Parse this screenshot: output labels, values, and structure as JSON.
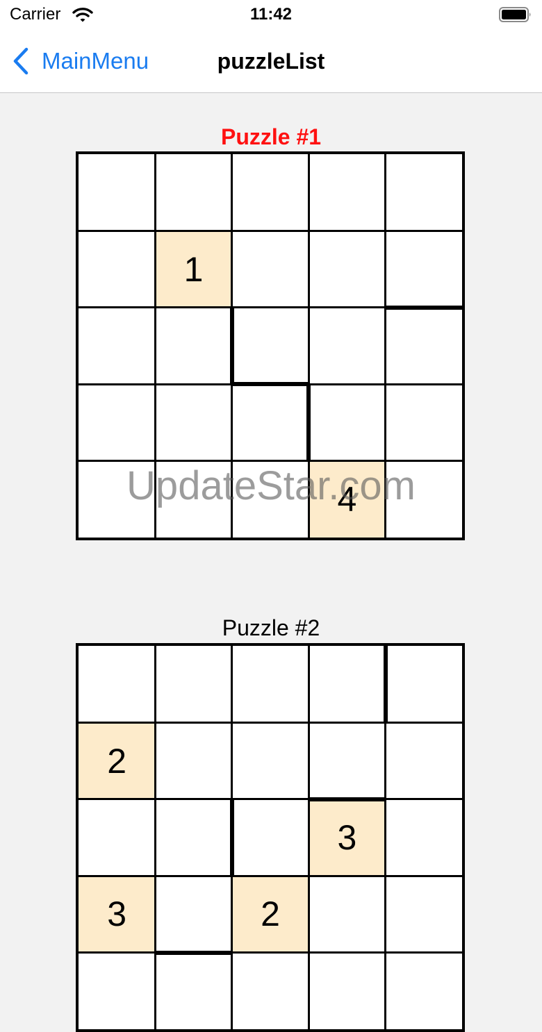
{
  "status_bar": {
    "carrier": "Carrier",
    "time": "11:42"
  },
  "nav": {
    "back_label": "MainMenu",
    "title": "puzzleList"
  },
  "colors": {
    "accent": "#1a7cf0",
    "selected_title": "#ff1111",
    "given_cell": "#fdebcb",
    "background": "#f2f2f2"
  },
  "puzzles": [
    {
      "title": "Puzzle #1",
      "selected": true,
      "cells": [
        [
          "",
          "",
          "",
          "",
          ""
        ],
        [
          "",
          "1",
          "",
          "",
          ""
        ],
        [
          "",
          "",
          "",
          "",
          ""
        ],
        [
          "",
          "",
          "",
          "",
          ""
        ],
        [
          "",
          "",
          "",
          "4",
          ""
        ]
      ],
      "thick_walls": {
        "horizontal": [
          [
            2,
            4
          ],
          [
            3,
            2
          ]
        ],
        "vertical": [
          [
            2,
            2
          ],
          [
            3,
            3
          ]
        ]
      }
    },
    {
      "title": "Puzzle #2",
      "selected": false,
      "cells": [
        [
          "",
          "",
          "",
          "",
          ""
        ],
        [
          "2",
          "",
          "",
          "",
          ""
        ],
        [
          "",
          "",
          "",
          "3",
          ""
        ],
        [
          "3",
          "",
          "2",
          "",
          ""
        ],
        [
          "",
          "",
          "",
          "",
          ""
        ]
      ],
      "thick_walls": {
        "horizontal": [
          [
            2,
            3
          ],
          [
            4,
            1
          ]
        ],
        "vertical": [
          [
            0,
            4
          ],
          [
            2,
            2
          ]
        ]
      }
    }
  ],
  "watermark": "UpdateStar.com"
}
